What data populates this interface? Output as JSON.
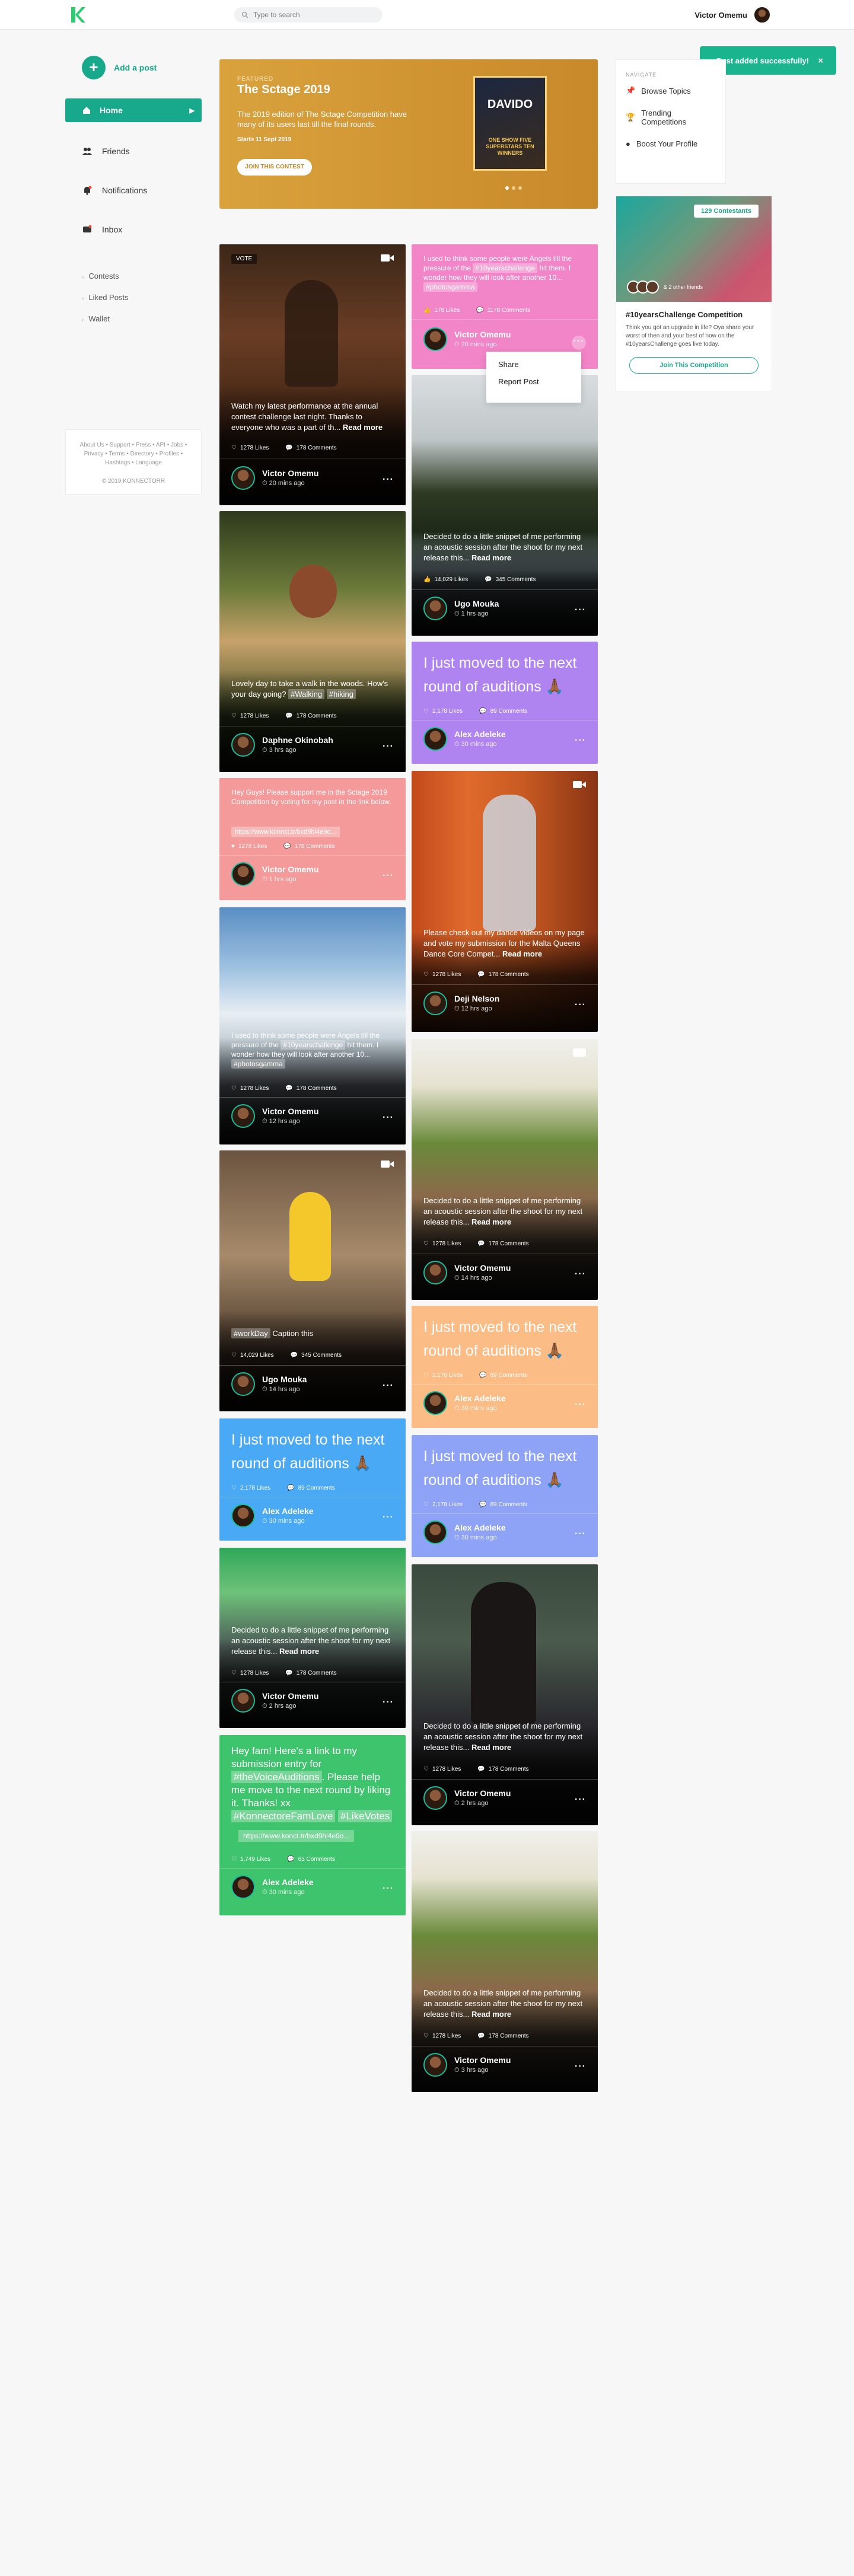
{
  "header": {
    "search_placeholder": "Type to search",
    "user_name": "Victor Omemu"
  },
  "sidebar": {
    "add_post": "Add a post",
    "items": [
      {
        "label": "Home"
      },
      {
        "label": "Friends"
      },
      {
        "label": "Notifications"
      },
      {
        "label": "Inbox"
      }
    ],
    "sub_items": [
      {
        "label": "Contests"
      },
      {
        "label": "Liked Posts"
      },
      {
        "label": "Wallet"
      }
    ],
    "footer_links": "About Us • Support • Press • API • Jobs • Privacy • Terms • Directory • Profiles • Hashtags • Language",
    "copyright": "© 2019 KONNECTORR"
  },
  "banner": {
    "featured": "FEATURED",
    "title": "The Sctage 2019",
    "description": "The 2019 edition of The Sctage Competition have many of its users last till the final rounds.",
    "starts": "Starts 11 Sept 2019",
    "join": "JOIN THIS CONTEST",
    "poster_title": "DAVIDO",
    "poster_sub": "ONE SHOW FIVE SUPERSTARS TEN WINNERS"
  },
  "toast": {
    "message": "Post added successfully!",
    "close": "×"
  },
  "right_nav": {
    "heading": "NAVIGATE",
    "items": [
      {
        "label": "Browse Topics"
      },
      {
        "label": "Trending Competitions"
      },
      {
        "label": "Boost Your Profile"
      }
    ]
  },
  "competition": {
    "badge": "129 Contestants",
    "friends": "& 2 other friends",
    "title": "#10yearsChallenge Competition",
    "description": "Think you got an upgrade in life? Oya share your worst of then and your best of now on the #10yearsChallenge goes live today.",
    "button": "Join This Competition"
  },
  "dropdown": {
    "share": "Share",
    "report": "Report Post"
  },
  "posts_left": [
    {
      "vote": "VOTE",
      "caption": "Watch my latest performance at the annual contest challenge last night. Thanks to everyone who was a part of th...",
      "more": "Read more",
      "likes": "1278 Likes",
      "comments": "178 Comments",
      "author": "Victor Omemu",
      "time": "20 mins ago"
    },
    {
      "caption": "Lovely day to take a walk in the woods. How's your day going?",
      "tags": [
        "#Walking",
        "#hiking"
      ],
      "likes": "1278 Likes",
      "comments": "178 Comments",
      "author": "Daphne Okinobah",
      "time": "3 hrs ago"
    },
    {
      "caption": "Hey Guys! Please support me in the Sctage 2019 Competition by voting for my post in the link below.",
      "link": "https://www.konnct.tr/bxd9hl4e9o...",
      "likes": "1278 Likes",
      "comments": "178 Comments",
      "author": "Victor Omemu",
      "time": "1 hrs ago"
    },
    {
      "caption": "I used to think some people were Angels till the pressure of the",
      "tag1": "#10yearschallenge",
      "caption2": "hit them. I wonder how they will look after another 10...",
      "tag2": "#photosgamma",
      "likes": "1278 Likes",
      "comments": "178 Comments",
      "author": "Victor Omemu",
      "time": "12 hrs ago"
    },
    {
      "tag": "#workDay",
      "caption": "Caption this",
      "likes": "14,029 Likes",
      "comments": "345 Comments",
      "author": "Ugo Mouka",
      "time": "14 hrs ago"
    },
    {
      "text": "I just moved to the next round of auditions 🙏🏾",
      "likes": "2,178 Likes",
      "comments": "89 Comments",
      "author": "Alex Adeleke",
      "time": "30 mins ago"
    },
    {
      "caption": "Decided to do a little snippet of me performing an acoustic session after the shoot for my next release this...",
      "more": "Read more",
      "likes": "1278 Likes",
      "comments": "178 Comments",
      "author": "Victor Omemu",
      "time": "2 hrs ago"
    },
    {
      "caption": "Hey fam! Here's a link to my submission entry for",
      "tag1": "#theVoiceAuditions",
      "caption2": ". Please help me move to the next round by liking it. Thanks! xx",
      "tag2": "#KonnectoreFamLove",
      "tag3": "#LikeVotes",
      "link": "https://www.konct.tr/bxd9hl4e9o...",
      "likes": "1,749 Likes",
      "comments": "63 Comments",
      "author": "Alex Adeleke",
      "time": "30 mins ago"
    }
  ],
  "posts_right": [
    {
      "caption": "I used to think some people were Angels till the pressure of the",
      "tag1": "#10yearschallenge",
      "caption2": "hit them. I wonder how they will look after another 10...",
      "tag2": "#photosgamma",
      "likes": "178 Likes",
      "comments": "1178 Comments",
      "author": "Victor Omemu",
      "time": "20 mins ago"
    },
    {
      "caption": "Decided to do a little snippet of me performing an acoustic session after the shoot for my next release this...",
      "more": "Read more",
      "likes": "14,029 Likes",
      "comments": "345 Comments",
      "author": "Ugo Mouka",
      "time": "1 hrs ago"
    },
    {
      "text": "I just moved to the next round of auditions 🙏🏾",
      "likes": "2,178 Likes",
      "comments": "89 Comments",
      "author": "Alex Adeleke",
      "time": "30 mins ago"
    },
    {
      "caption": "Please check out my dance videos on my page and vote my submission for the Malta Queens Dance Core Compet...",
      "more": "Read more",
      "likes": "1278 Likes",
      "comments": "178 Comments",
      "author": "Deji Nelson",
      "time": "12 hrs ago"
    },
    {
      "caption": "Decided to do a little snippet of me performing an acoustic session after the shoot for my next release this...",
      "more": "Read more",
      "likes": "1278 Likes",
      "comments": "178 Comments",
      "author": "Victor Omemu",
      "time": "14 hrs ago"
    },
    {
      "text": "I just moved to the next round of auditions 🙏🏾",
      "likes": "2,178 Likes",
      "comments": "89 Comments",
      "author": "Alex Adeleke",
      "time": "30 mins ago"
    },
    {
      "text": "I just moved to the next round of auditions 🙏🏾",
      "likes": "2,178 Likes",
      "comments": "89 Comments",
      "author": "Alex Adeleke",
      "time": "30 mins ago"
    },
    {
      "caption": "Decided to do a little snippet of me performing an acoustic session after the shoot for my next release this...",
      "more": "Read more",
      "likes": "1278 Likes",
      "comments": "178 Comments",
      "author": "Victor Omemu",
      "time": "2 hrs ago"
    },
    {
      "caption": "Decided to do a little snippet of me performing an acoustic session after the shoot for my next release this...",
      "more": "Read more",
      "likes": "1278 Likes",
      "comments": "178 Comments",
      "author": "Victor Omemu",
      "time": "3 hrs ago"
    }
  ],
  "colors": {
    "accent": "#18a88c",
    "banner": "#d39a35",
    "pink": "#f285c8",
    "purple": "#b084f0",
    "salmon": "#f49a9a",
    "peach": "#fbbd85",
    "periwinkle": "#8ea3f5",
    "sky": "#4aa9f5",
    "green": "#3ec46d"
  }
}
